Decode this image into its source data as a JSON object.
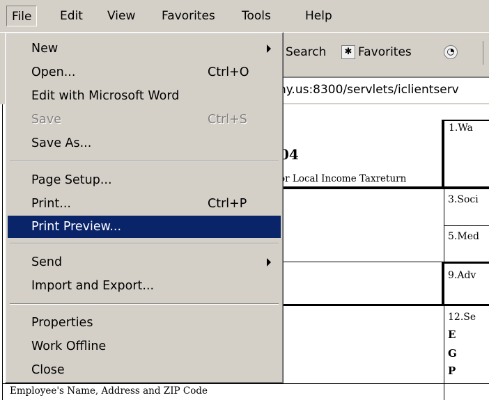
{
  "menubar": {
    "items": [
      "File",
      "Edit",
      "View",
      "Favorites",
      "Tools",
      "Help"
    ]
  },
  "toolbar": {
    "search_label": "Search",
    "favorites_label": "Favorites"
  },
  "address": {
    "value": "ny.us:8300/servlets/iclientserv"
  },
  "form": {
    "box1": "1.Wa",
    "year_fragment": "04",
    "tax_fragment": "or Local Income Taxreturn",
    "box3": "3.Soci",
    "box5": "5.Med",
    "box9": "9.Adv",
    "box12": "12.Se",
    "box12_codes": [
      "E",
      "G",
      "P"
    ],
    "employee_label": "Employee's Name, Address and ZIP Code"
  },
  "file_menu": {
    "new": "New",
    "open": "Open...",
    "open_shortcut": "Ctrl+O",
    "edit_word": "Edit with Microsoft Word",
    "save": "Save",
    "save_shortcut": "Ctrl+S",
    "save_as": "Save As...",
    "page_setup": "Page Setup...",
    "print": "Print...",
    "print_shortcut": "Ctrl+P",
    "print_preview": "Print Preview...",
    "send": "Send",
    "import_export": "Import and Export...",
    "properties": "Properties",
    "work_offline": "Work Offline",
    "close": "Close"
  }
}
